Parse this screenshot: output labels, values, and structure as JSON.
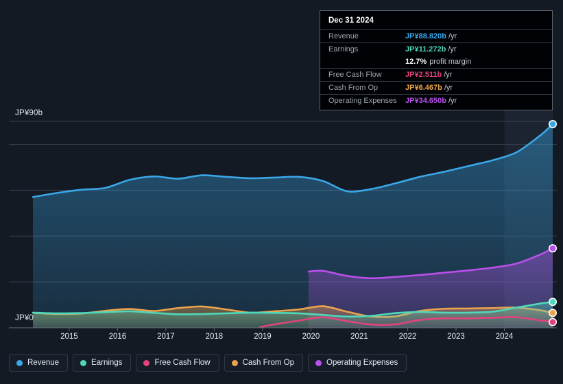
{
  "axis": {
    "y_top_label": "JP¥90b",
    "y_bottom_label": "JP¥0",
    "x_labels": [
      "2015",
      "2016",
      "2017",
      "2018",
      "2019",
      "2020",
      "2021",
      "2022",
      "2023",
      "2024"
    ]
  },
  "tooltip": {
    "date": "Dec 31 2024",
    "rows": [
      {
        "key": "Revenue",
        "value": "JP¥88.820b",
        "unit": "/yr",
        "color": "#3aa7e8"
      },
      {
        "key": "Earnings",
        "value": "JP¥11.272b",
        "unit": "/yr",
        "color": "#4fd8bb"
      },
      {
        "key": "",
        "value": "12.7%",
        "unit": "",
        "sub": "profit margin",
        "color": "#ffffff"
      },
      {
        "key": "Free Cash Flow",
        "value": "JP¥2.511b",
        "unit": "/yr",
        "color": "#e2437d"
      },
      {
        "key": "Cash From Op",
        "value": "JP¥6.467b",
        "unit": "/yr",
        "color": "#eba44d"
      },
      {
        "key": "Operating Expenses",
        "value": "JP¥34.650b",
        "unit": "/yr",
        "color": "#b950ea"
      }
    ]
  },
  "legend": {
    "items": [
      {
        "label": "Revenue",
        "color": "#3aa7e8"
      },
      {
        "label": "Earnings",
        "color": "#4fd8bb"
      },
      {
        "label": "Free Cash Flow",
        "color": "#e2437d"
      },
      {
        "label": "Cash From Op",
        "color": "#eba44d"
      },
      {
        "label": "Operating Expenses",
        "color": "#b950ea"
      }
    ]
  },
  "chart_data": {
    "type": "area",
    "title": "",
    "xlabel": "",
    "ylabel": "",
    "currency": "JP¥",
    "unit": "b",
    "ylim": [
      0,
      90
    ],
    "xlim": [
      2014.25,
      2025.0
    ],
    "grid": true,
    "legend_position": "bottom",
    "gridline_values": [
      90,
      80,
      60,
      40,
      20,
      0
    ],
    "highlight_band": {
      "from": 2024.0,
      "to": 2025.0
    },
    "series": [
      {
        "name": "Revenue",
        "color": "#3aa7e8",
        "fill": true,
        "x": [
          2014.25,
          2014.75,
          2015.25,
          2015.75,
          2016.25,
          2016.75,
          2017.25,
          2017.75,
          2018.25,
          2018.75,
          2019.25,
          2019.75,
          2020.25,
          2020.75,
          2021.25,
          2021.75,
          2022.25,
          2022.75,
          2023.25,
          2023.75,
          2024.25,
          2024.75,
          2025.0
        ],
        "y": [
          57.0,
          58.8,
          60.2,
          61.0,
          64.5,
          66.0,
          65.0,
          66.5,
          65.8,
          65.2,
          65.5,
          65.8,
          64.0,
          59.5,
          60.5,
          63.0,
          65.8,
          68.0,
          70.5,
          73.0,
          76.5,
          84.0,
          88.82
        ]
      },
      {
        "name": "Earnings",
        "color": "#4fd8bb",
        "fill": true,
        "x": [
          2014.25,
          2014.75,
          2015.25,
          2015.75,
          2016.25,
          2016.75,
          2017.25,
          2017.75,
          2018.25,
          2018.75,
          2019.25,
          2019.75,
          2020.25,
          2020.75,
          2021.25,
          2021.75,
          2022.25,
          2022.75,
          2023.25,
          2023.75,
          2024.25,
          2024.75,
          2025.0
        ],
        "y": [
          6.6,
          6.3,
          6.4,
          6.8,
          7.2,
          6.5,
          5.9,
          6.0,
          6.3,
          6.6,
          6.5,
          6.3,
          5.6,
          4.9,
          5.2,
          6.4,
          6.9,
          6.6,
          6.6,
          7.0,
          8.8,
          10.6,
          11.272
        ]
      },
      {
        "name": "Free Cash Flow",
        "color": "#e2437d",
        "fill": false,
        "x": [
          2018.95,
          2019.25,
          2019.75,
          2020.25,
          2020.75,
          2021.25,
          2021.75,
          2022.25,
          2022.75,
          2023.25,
          2023.75,
          2024.25,
          2024.75,
          2025.0
        ],
        "y": [
          0.3,
          1.5,
          3.1,
          4.6,
          2.9,
          1.4,
          1.5,
          3.4,
          4.1,
          4.1,
          4.4,
          4.6,
          3.2,
          2.511
        ]
      },
      {
        "name": "Cash From Op",
        "color": "#eba44d",
        "fill": true,
        "x": [
          2014.25,
          2014.75,
          2015.25,
          2015.75,
          2016.25,
          2016.75,
          2017.25,
          2017.75,
          2018.25,
          2018.75,
          2019.25,
          2019.75,
          2020.25,
          2020.75,
          2021.25,
          2021.75,
          2022.25,
          2022.75,
          2023.25,
          2023.75,
          2024.25,
          2024.75,
          2025.0
        ],
        "y": [
          6.5,
          6.0,
          6.2,
          7.4,
          8.2,
          7.3,
          8.6,
          9.3,
          8.0,
          6.6,
          7.2,
          8.0,
          9.4,
          7.0,
          4.9,
          5.0,
          7.3,
          8.3,
          8.4,
          8.6,
          8.8,
          7.6,
          6.467
        ]
      },
      {
        "name": "Operating Expenses",
        "color": "#b950ea",
        "fill": true,
        "x": [
          2019.95,
          2020.25,
          2020.75,
          2021.25,
          2021.75,
          2022.25,
          2022.75,
          2023.25,
          2023.75,
          2024.25,
          2024.75,
          2025.0
        ],
        "y": [
          24.5,
          24.8,
          22.6,
          21.6,
          22.2,
          23.0,
          24.0,
          25.0,
          26.2,
          28.0,
          32.0,
          34.65
        ]
      }
    ],
    "end_markers": [
      {
        "series": "Revenue",
        "value": 88.82,
        "color": "#3aa7e8"
      },
      {
        "series": "Operating Expenses",
        "value": 34.65,
        "color": "#b950ea"
      },
      {
        "series": "Earnings",
        "value": 11.272,
        "color": "#4fd8bb"
      },
      {
        "series": "Cash From Op",
        "value": 6.467,
        "color": "#eba44d"
      },
      {
        "series": "Free Cash Flow",
        "value": 2.511,
        "color": "#e2437d"
      }
    ]
  }
}
